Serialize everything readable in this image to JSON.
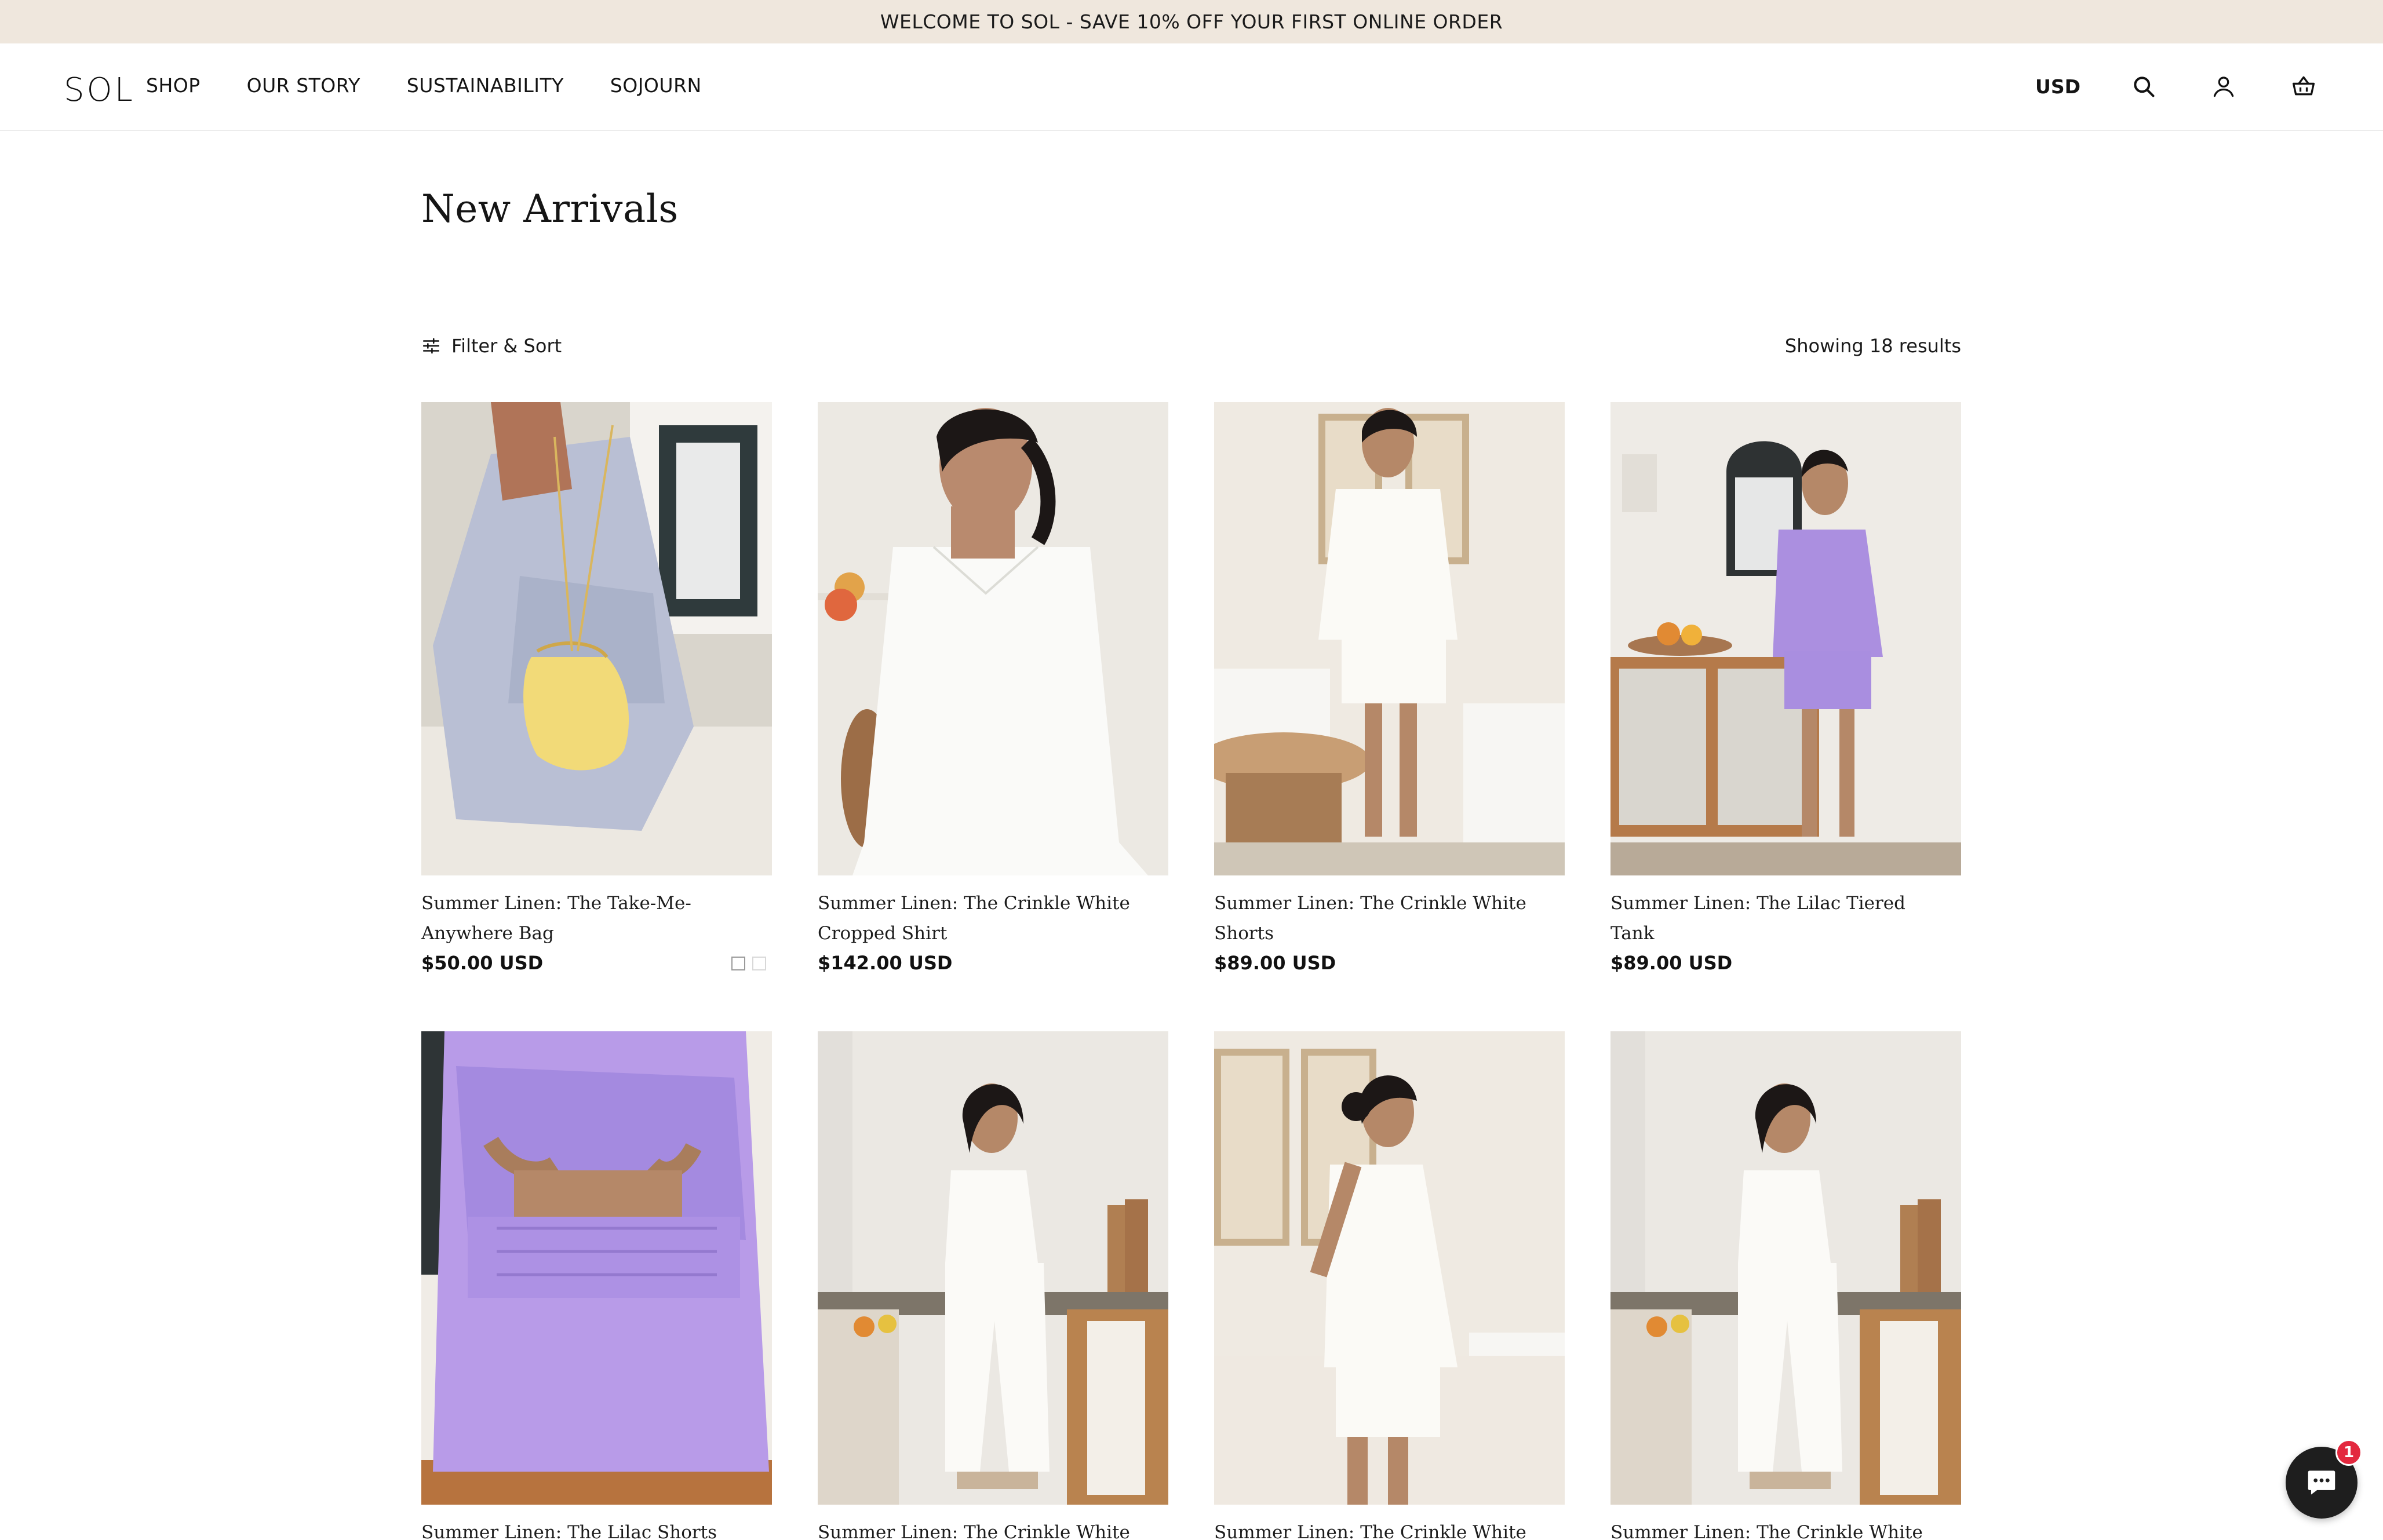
{
  "announcement": "WELCOME TO SOL - SAVE 10% OFF YOUR FIRST ONLINE ORDER",
  "header": {
    "logo": "SOL",
    "nav": [
      "SHOP",
      "OUR STORY",
      "SUSTAINABILITY",
      "SOJOURN"
    ],
    "currency": "USD",
    "icons": [
      "search-icon",
      "account-icon",
      "cart-icon"
    ]
  },
  "page": {
    "title": "New Arrivals",
    "filter_label": "Filter & Sort",
    "results": "Showing 18 results"
  },
  "products": [
    {
      "title": "Summer Linen: The Take-Me-Anywhere Bag",
      "price": "$50.00 USD",
      "swatches": 2
    },
    {
      "title": "Summer Linen: The Crinkle White Cropped Shirt",
      "price": "$142.00 USD"
    },
    {
      "title": "Summer Linen: The Crinkle White Shorts",
      "price": "$89.00 USD"
    },
    {
      "title": "Summer Linen: The Lilac Tiered Tank",
      "price": "$89.00 USD"
    },
    {
      "title": "Summer Linen: The Lilac Shorts",
      "price": ""
    },
    {
      "title": "Summer Linen: The Crinkle White",
      "price": ""
    },
    {
      "title": "Summer Linen: The Crinkle White Tiered",
      "price": ""
    },
    {
      "title": "Summer Linen: The Crinkle White",
      "price": ""
    }
  ],
  "colors": {
    "announcement_bg": "#efe7dd",
    "lilac": "#a98ee0",
    "chat_badge": "#e3283e"
  },
  "chat": {
    "badge": "1"
  }
}
